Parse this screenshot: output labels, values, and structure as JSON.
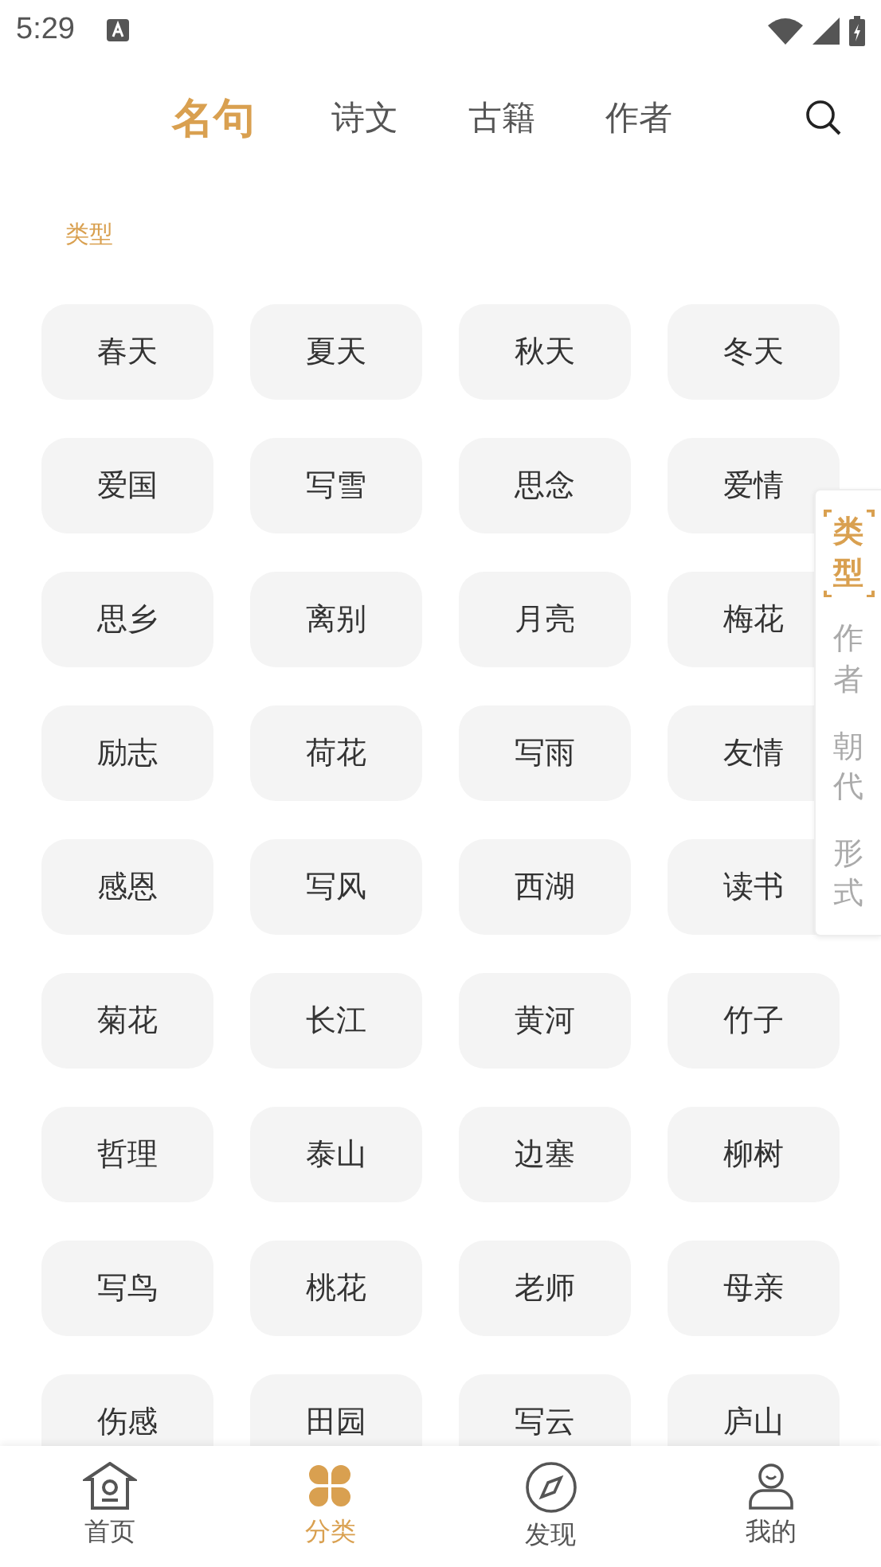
{
  "status_bar": {
    "time": "5:29"
  },
  "tabs": [
    {
      "label": "名句",
      "selected": true
    },
    {
      "label": "诗文",
      "selected": false
    },
    {
      "label": "古籍",
      "selected": false
    },
    {
      "label": "作者",
      "selected": false
    }
  ],
  "section_title": "类型",
  "categories": [
    "春天",
    "夏天",
    "秋天",
    "冬天",
    "爱国",
    "写雪",
    "思念",
    "爱情",
    "思乡",
    "离别",
    "月亮",
    "梅花",
    "励志",
    "荷花",
    "写雨",
    "友情",
    "感恩",
    "写风",
    "西湖",
    "读书",
    "菊花",
    "长江",
    "黄河",
    "竹子",
    "哲理",
    "泰山",
    "边塞",
    "柳树",
    "写鸟",
    "桃花",
    "老师",
    "母亲",
    "伤感",
    "田园",
    "写云",
    "庐山"
  ],
  "side_index": [
    {
      "label": "类型",
      "selected": true
    },
    {
      "label": "作者",
      "selected": false
    },
    {
      "label": "朝代",
      "selected": false
    },
    {
      "label": "形式",
      "selected": false
    }
  ],
  "bottom_nav": [
    {
      "label": "首页",
      "kind": "home",
      "selected": false
    },
    {
      "label": "分类",
      "kind": "category",
      "selected": true
    },
    {
      "label": "发现",
      "kind": "discover",
      "selected": false
    },
    {
      "label": "我的",
      "kind": "profile",
      "selected": false
    }
  ]
}
